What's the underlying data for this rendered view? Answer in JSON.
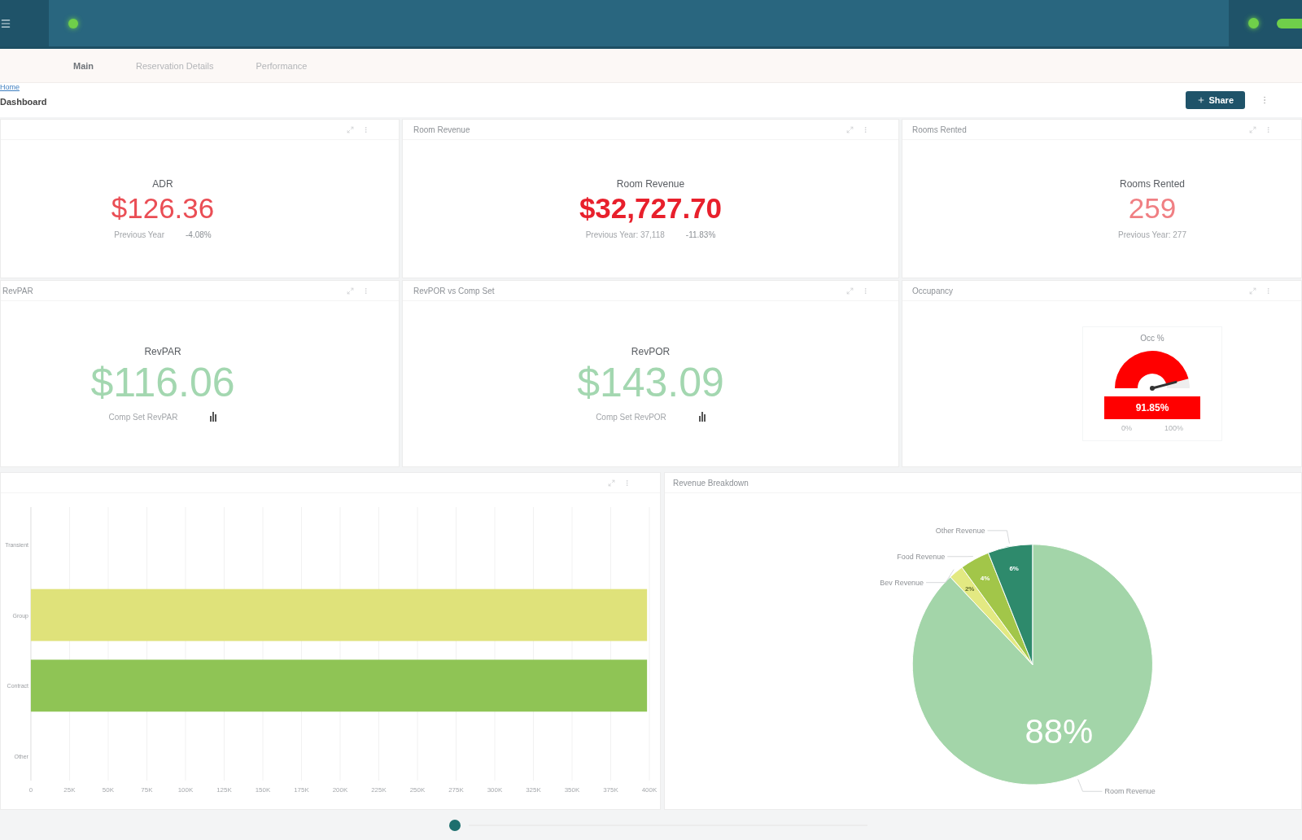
{
  "tabs": [
    {
      "label": "Main",
      "selected": true
    },
    {
      "label": "Reservation Details",
      "selected": false
    },
    {
      "label": "Performance",
      "selected": false
    }
  ],
  "breadcrumb": {
    "link": "Home",
    "current": "Dashboard"
  },
  "share_button": {
    "label": "Share"
  },
  "kpi_rows": [
    [
      {
        "kind": "stat",
        "label": "ADR",
        "value": "$126.36",
        "color": "#ea4e55",
        "bold": false,
        "note": "Previous Year",
        "change": "-4.08%"
      },
      {
        "kind": "stat",
        "title": "Room Revenue",
        "label": "Room Revenue",
        "value": "$32,727.70",
        "color": "#e8202c",
        "bold": true,
        "note": "Previous Year: 37,118",
        "change": "-11.83%"
      },
      {
        "kind": "stat",
        "title": "Rooms Rented",
        "label": "Rooms Rented",
        "value": "259",
        "color": "#f07f83",
        "bold": false,
        "note": "Previous Year: 277"
      }
    ],
    [
      {
        "kind": "stat",
        "title": "RevPAR",
        "label": "RevPAR",
        "value": "$116.06",
        "color": "#a3d7b0",
        "bold": false,
        "note": "Comp Set RevPAR",
        "chart_link": true
      },
      {
        "kind": "stat",
        "title": "RevPOR vs Comp Set",
        "label": "RevPOR",
        "value": "$143.09",
        "color": "#a3d7b0",
        "bold": false,
        "note": "Comp Set RevPOR",
        "chart_link": true
      },
      {
        "kind": "gauge",
        "title": "Occupancy",
        "label": "Occ %",
        "level": 0.9185,
        "reading": "91.85%",
        "min": "0%",
        "max": "100%"
      }
    ]
  ],
  "bar_panel": {
    "chart_data": {
      "type": "bar",
      "orientation": "horizontal",
      "stacked": true,
      "grid": true,
      "categories": [
        "Transient",
        "Group",
        "Contract",
        "Other"
      ],
      "series": [
        {
          "color": "#dfe27a",
          "values": [
            0,
            398500,
            0,
            0
          ]
        },
        {
          "color": "#8fc455",
          "values": [
            0,
            0,
            398500,
            0
          ]
        }
      ],
      "xlim": [
        0,
        400000
      ],
      "xticks": [
        {
          "value": 0,
          "label": "0"
        },
        {
          "value": 25000,
          "label": "25K"
        },
        {
          "value": 50000,
          "label": "50K"
        },
        {
          "value": 75000,
          "label": "75K"
        },
        {
          "value": 100000,
          "label": "100K"
        },
        {
          "value": 125000,
          "label": "125K"
        },
        {
          "value": 150000,
          "label": "150K"
        },
        {
          "value": 175000,
          "label": "175K"
        },
        {
          "value": 200000,
          "label": "200K"
        },
        {
          "value": 225000,
          "label": "225K"
        },
        {
          "value": 250000,
          "label": "250K"
        },
        {
          "value": 275000,
          "label": "275K"
        },
        {
          "value": 300000,
          "label": "300K"
        },
        {
          "value": 325000,
          "label": "325K"
        },
        {
          "value": 350000,
          "label": "350K"
        },
        {
          "value": 375000,
          "label": "375K"
        },
        {
          "value": 400000,
          "label": "400K"
        }
      ]
    }
  },
  "pie_panel": {
    "title": "Revenue Breakdown",
    "chart_data": {
      "type": "pie",
      "categories": [
        "Room Revenue",
        "Bev Revenue",
        "Food Revenue",
        "Other Revenue"
      ],
      "values": [
        88,
        2,
        4,
        6
      ],
      "colors": [
        "#a3d5a9",
        "#e3e982",
        "#a2c649",
        "#2e8a6c"
      ],
      "value_labels": [
        "88%",
        "2%",
        "4%",
        "6%"
      ]
    }
  }
}
